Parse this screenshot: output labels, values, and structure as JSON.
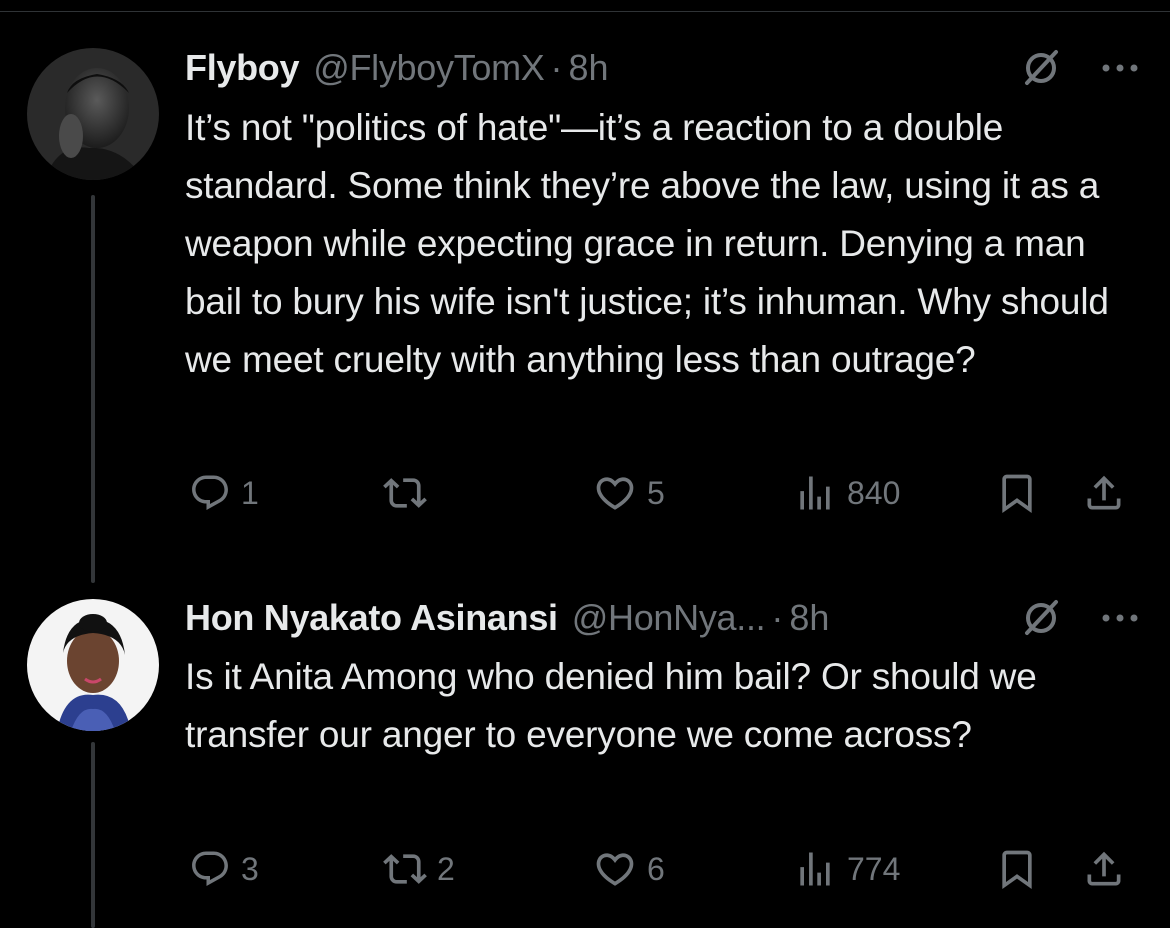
{
  "tweets": [
    {
      "name": "Flyboy",
      "handle": "@FlyboyTomX",
      "separator": "·",
      "time": "8h",
      "text": "It’s not \"politics of hate\"—it’s a reaction to a double standard. Some think they’re above the law, using it as a weapon while expecting grace in return. Denying a man bail to bury his wife isn't justice; it’s inhuman. Why should we meet cruelty with anything less than outrage?",
      "replies": "1",
      "reposts": "",
      "likes": "5",
      "views": "840"
    },
    {
      "name": "Hon Nyakato Asinansi",
      "handle": "@HonNya...",
      "separator": "·",
      "time": "8h",
      "text": "Is it Anita Among who denied him bail? Or should we transfer our anger to everyone we come across?",
      "replies": "3",
      "reposts": "2",
      "likes": "6",
      "views": "774"
    }
  ],
  "icons": {
    "reply": "reply-icon",
    "repost": "repost-icon",
    "like": "like-icon",
    "views": "views-icon",
    "bookmark": "bookmark-icon",
    "share": "share-icon",
    "grok": "grok-icon",
    "more": "more-icon"
  },
  "colors": {
    "background": "#000000",
    "primary_text": "#e7e9ea",
    "secondary_text": "#71767b",
    "thread_line": "#333639"
  }
}
